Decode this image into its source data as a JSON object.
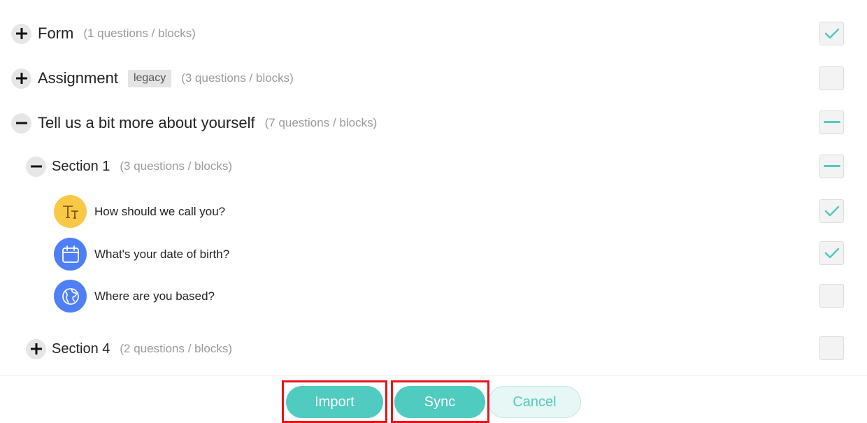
{
  "rows": [
    {
      "title": "Form",
      "count": "(1 questions / blocks)"
    },
    {
      "title": "Assignment",
      "tag": "legacy",
      "count": "(3 questions / blocks)"
    },
    {
      "title": "Tell us a bit more about yourself",
      "count": "(7 questions / blocks)"
    }
  ],
  "sections": [
    {
      "title": "Section 1",
      "count": "(3 questions / blocks)"
    },
    {
      "title": "Section 4",
      "count": "(2 questions / blocks)"
    }
  ],
  "questions": [
    {
      "text": "How should we call you?",
      "icon": "text-type-icon",
      "icon_color": "#f9c846"
    },
    {
      "text": "What's your date of birth?",
      "icon": "calendar-icon",
      "icon_color": "#4f7ff5"
    },
    {
      "text": "Where are you based?",
      "icon": "globe-icon",
      "icon_color": "#4f7ff5"
    }
  ],
  "footer": {
    "import_label": "Import",
    "sync_label": "Sync",
    "cancel_label": "Cancel"
  },
  "colors": {
    "accent": "#4fcbbf",
    "highlight": "#e8141a"
  }
}
